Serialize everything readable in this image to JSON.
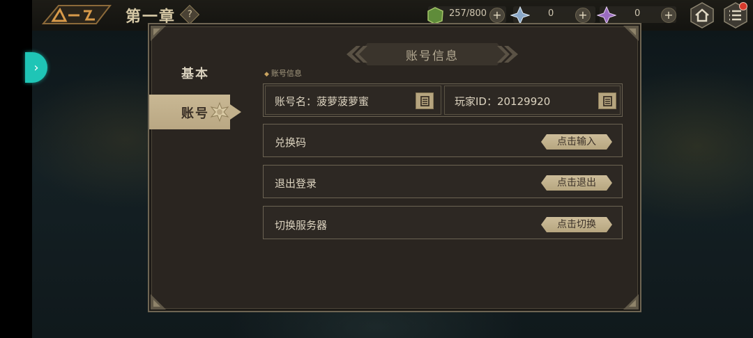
{
  "header": {
    "chapter": "第一章",
    "help_glyph": "?",
    "resources": [
      {
        "icon": "green-crystal-icon",
        "value": "257/800"
      },
      {
        "icon": "blue-star-icon",
        "value": "0"
      },
      {
        "icon": "purple-star-icon",
        "value": "0"
      }
    ],
    "plus_glyph": "+"
  },
  "tabs": [
    {
      "label": "基本",
      "selected": false
    },
    {
      "label": "账号",
      "selected": true
    }
  ],
  "panel": {
    "title": "账号信息",
    "section_label": "账号信息"
  },
  "account": {
    "name_label": "账号名：菠萝菠萝蜜",
    "id_label": "玩家ID：20129920"
  },
  "rows": [
    {
      "label": "兑换码",
      "button": "点击输入"
    },
    {
      "label": "退出登录",
      "button": "点击退出"
    },
    {
      "label": "切换服务器",
      "button": "点击切换"
    }
  ],
  "colors": {
    "accent_teal": "#1fc5b6",
    "panel_bg": "#2a2520",
    "button_tan": "#c6b58f",
    "badge_red": "#d83a2c"
  }
}
